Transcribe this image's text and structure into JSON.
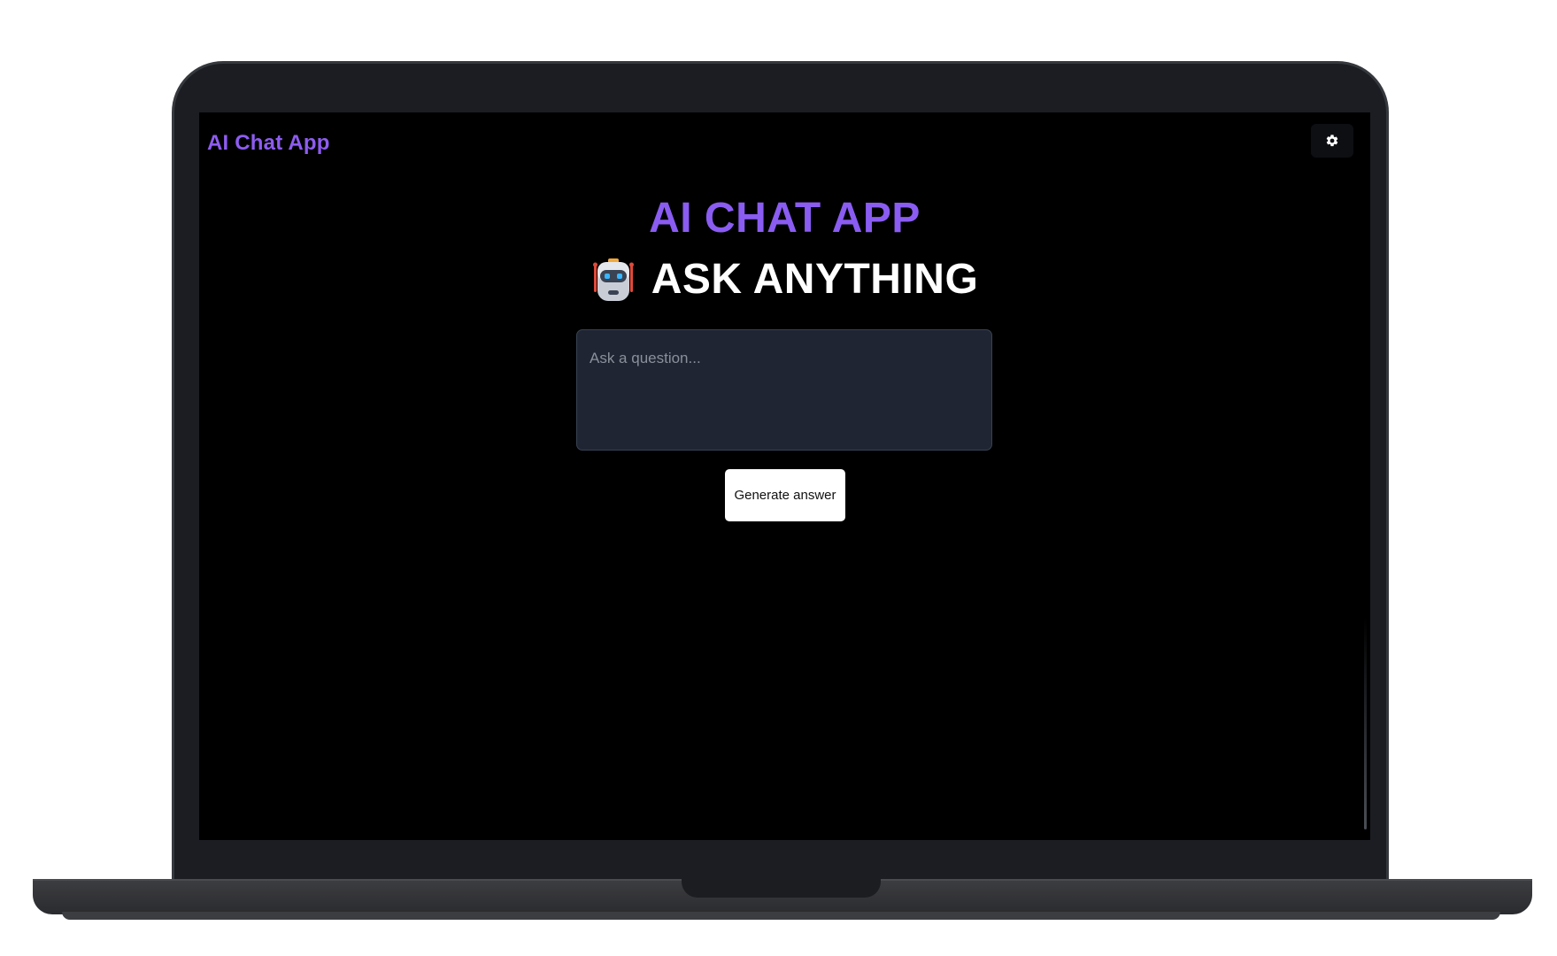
{
  "app": {
    "brand": "AI Chat App"
  },
  "toolbar": {
    "theme_toggle_icon": "gear-icon"
  },
  "hero": {
    "title": "AI CHAT APP",
    "subtitle": "ASK ANYTHING",
    "subtitle_icon": "robot-icon"
  },
  "question": {
    "placeholder": "Ask a question...",
    "value": ""
  },
  "actions": {
    "generate_label": "Generate answer"
  },
  "colors": {
    "accent": "#8a5cf1",
    "background": "#000000",
    "input_background": "#1f2532",
    "button_background": "#ffffff"
  }
}
